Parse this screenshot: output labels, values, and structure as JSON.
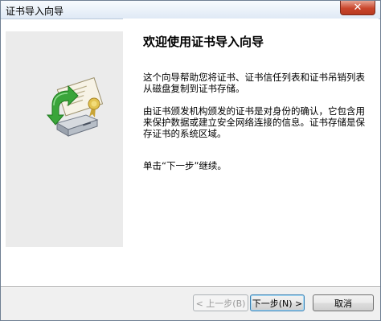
{
  "window": {
    "title": "证书导入向导",
    "close_symbol": "✕"
  },
  "main": {
    "heading": "欢迎使用证书导入向导",
    "paragraph1": "这个向导帮助您将证书、证书信任列表和证书吊销列表从磁盘复制到证书存储。",
    "paragraph2": "由证书颁发机构颁发的证书是对身份的确认，它包含用来保护数据或建立安全网络连接的信息。证书存储是保存证书的系统区域。",
    "paragraph3": "单击“下一步”继续。"
  },
  "footer": {
    "back_label": "< 上一步(B)",
    "next_label": "下一步(N) >",
    "cancel_label": "取消"
  },
  "icons": {
    "side": "certificate-import-icon"
  },
  "colors": {
    "side_panel": "#ebebeb",
    "close_button": "#c9462c",
    "arrow_green": "#3aa53a"
  }
}
